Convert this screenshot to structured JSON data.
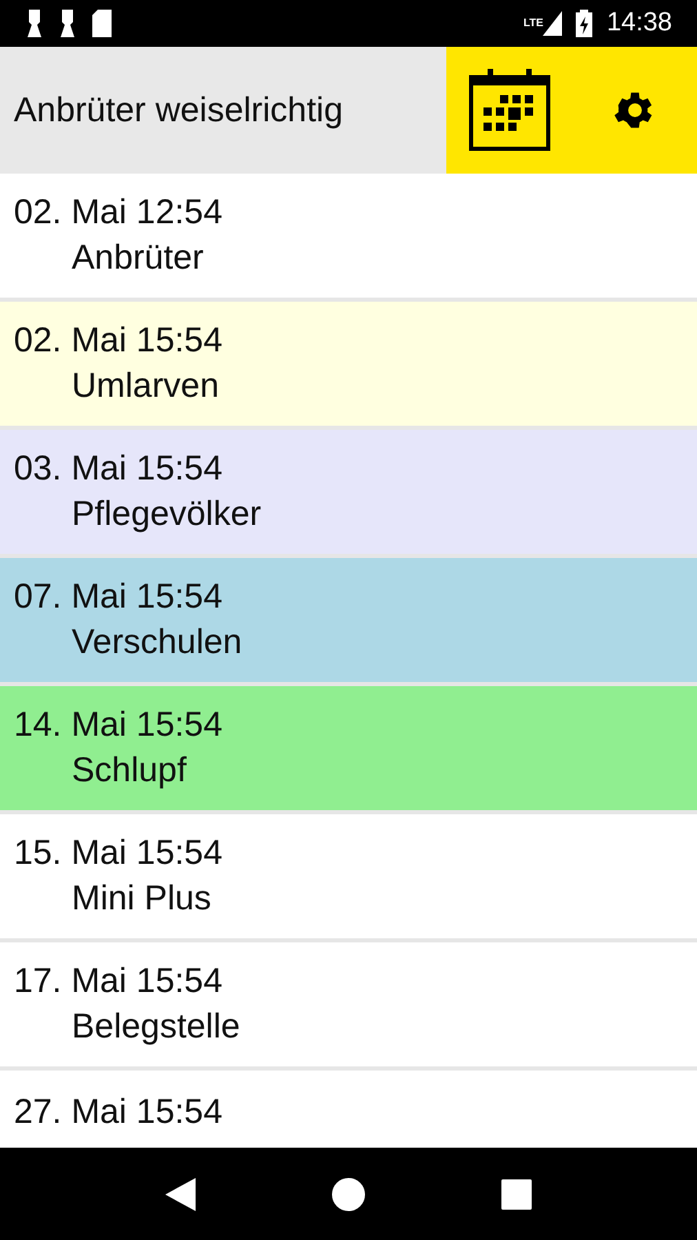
{
  "status_bar": {
    "time": "14:38",
    "network": "LTE"
  },
  "header": {
    "title": "Anbrüter weiselrichtig"
  },
  "events": [
    {
      "date": "02. Mai 12:54",
      "name": "Anbrüter",
      "color": "#ffffff"
    },
    {
      "date": "02. Mai 15:54",
      "name": "Umlarven",
      "color": "#ffffe0"
    },
    {
      "date": "03. Mai 15:54",
      "name": "Pflegevölker",
      "color": "#e6e6fa"
    },
    {
      "date": "07. Mai 15:54",
      "name": "Verschulen",
      "color": "#add8e6"
    },
    {
      "date": "14. Mai 15:54",
      "name": "Schlupf",
      "color": "#90ee90"
    },
    {
      "date": "15. Mai 15:54",
      "name": "Mini Plus",
      "color": "#ffffff"
    },
    {
      "date": "17. Mai 15:54",
      "name": "Belegstelle",
      "color": "#ffffff"
    },
    {
      "date": "27. Mai 15:54",
      "color": "#ffffff"
    }
  ]
}
